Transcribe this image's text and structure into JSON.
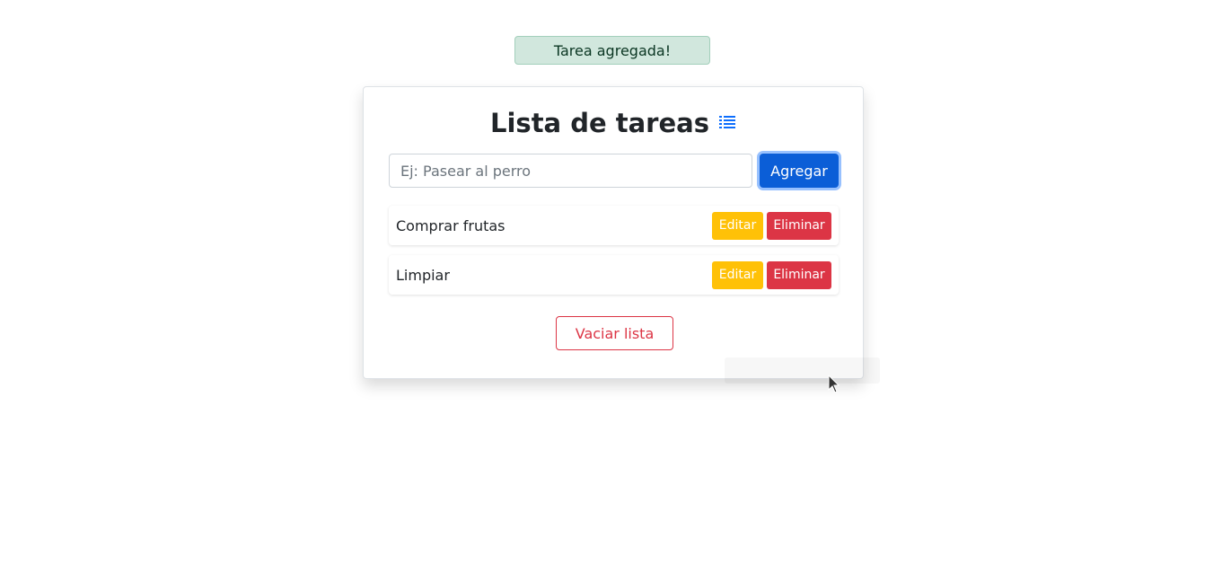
{
  "toast": {
    "message": "Tarea agregada!"
  },
  "header": {
    "title": "Lista de tareas",
    "icon": "list-icon"
  },
  "form": {
    "placeholder": "Ej: Pasear al perro",
    "value": "",
    "add_label": "Agregar"
  },
  "tasks": [
    {
      "text": "Comprar frutas",
      "edit_label": "Editar",
      "delete_label": "Eliminar"
    },
    {
      "text": "Limpiar",
      "edit_label": "Editar",
      "delete_label": "Eliminar"
    }
  ],
  "actions": {
    "clear_label": "Vaciar lista"
  },
  "colors": {
    "primary": "#0b5ed7",
    "warning": "#ffc107",
    "danger": "#dc3545",
    "success_bg": "#d1e7dd",
    "success_text": "#0a3622",
    "icon_blue": "#0d6efd"
  }
}
